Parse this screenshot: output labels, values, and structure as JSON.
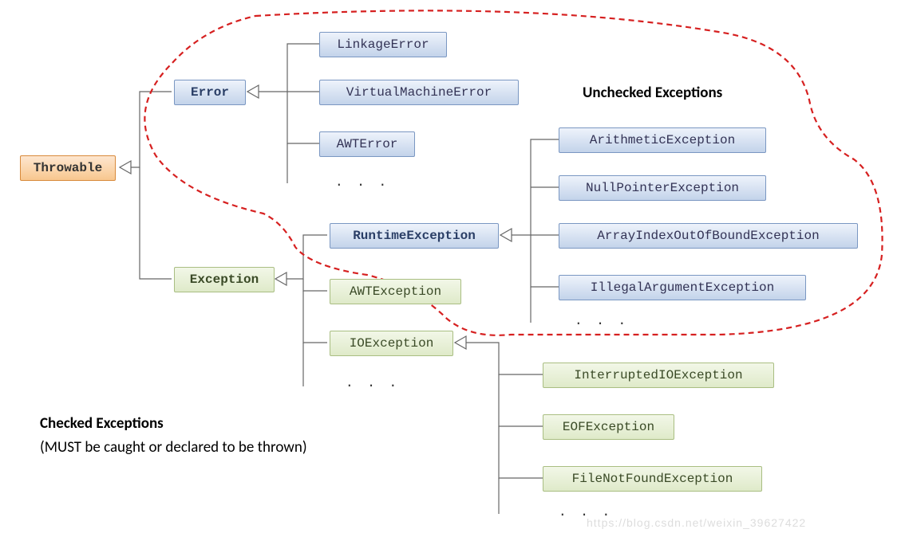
{
  "root": "Throwable",
  "error": {
    "name": "Error",
    "children": [
      "LinkageError",
      "VirtualMachineError",
      "AWTError"
    ],
    "ellipsis": ". . ."
  },
  "exception": {
    "name": "Exception",
    "runtime": {
      "name": "RuntimeException",
      "children": [
        "ArithmeticException",
        "NullPointerException",
        "ArrayIndexOutOfBoundException",
        "IllegalArgumentException"
      ],
      "ellipsis": ". . ."
    },
    "checked_children": [
      "AWTException",
      "IOException"
    ],
    "ellipsis": ". . .",
    "io_children": [
      "InterruptedIOException",
      "EOFException",
      "FileNotFoundException"
    ],
    "io_ellipsis": ". . ."
  },
  "labels": {
    "unchecked": "Unchecked Exceptions",
    "checked_title": "Checked Exceptions",
    "checked_sub": "(MUST be caught or declared to be thrown)"
  },
  "watermark": "https://blog.csdn.net/weixin_39627422"
}
